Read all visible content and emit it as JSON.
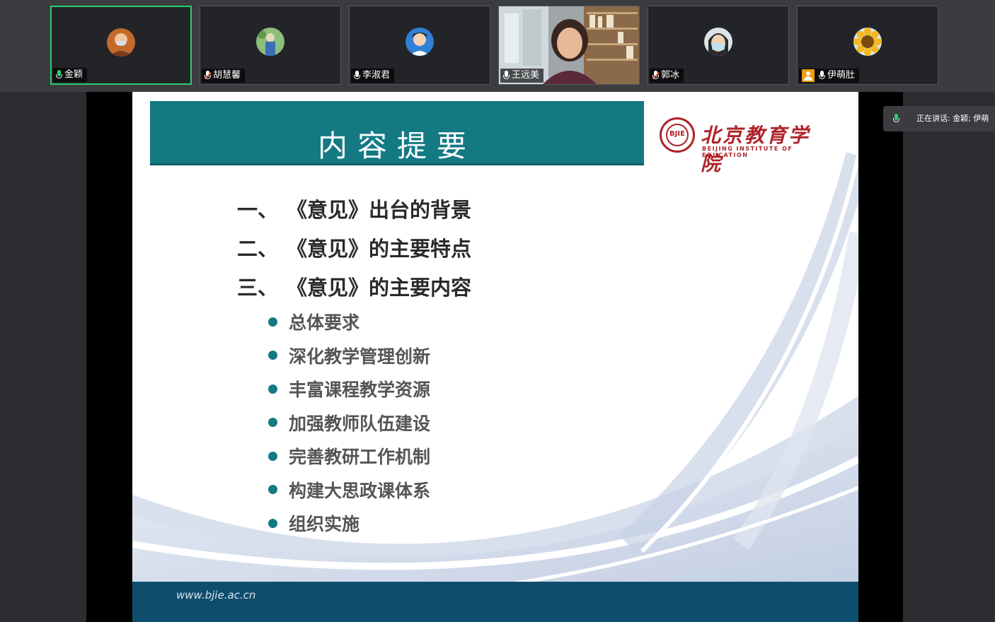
{
  "participants": [
    {
      "name": "金颖",
      "mic": "on-active",
      "active": true,
      "avatar": "photo-woman-glasses-icon"
    },
    {
      "name": "胡慧馨",
      "mic": "muted",
      "active": false,
      "avatar": "photo-outdoor-icon"
    },
    {
      "name": "李淑君",
      "mic": "on",
      "active": false,
      "avatar": "photo-woman-icon"
    },
    {
      "name": "王远美",
      "mic": "on",
      "active": false,
      "avatar": "video-feed"
    },
    {
      "name": "郭冰",
      "mic": "muted",
      "active": false,
      "avatar": "photo-masked-icon"
    },
    {
      "name": "伊萌肚",
      "mic": "on",
      "active": false,
      "avatar": "sunflower-icon"
    }
  ],
  "speaking": {
    "text": "正在讲话: 金颖; 伊萌"
  },
  "slide": {
    "title": "内容提要",
    "logo_cn": "北京教育学院",
    "logo_en": "BEIJING INSTITUTE OF EDUCATION",
    "seal_text": "BJIE",
    "headings": [
      {
        "num": "一、",
        "text": "《意见》出台的背景"
      },
      {
        "num": "二、",
        "text": "《意见》的主要特点"
      },
      {
        "num": "三、",
        "text": "《意见》的主要内容"
      }
    ],
    "items": [
      "总体要求",
      "深化教学管理创新",
      "丰富课程教学资源",
      "加强教师队伍建设",
      "完善教研工作机制",
      "构建大思政课体系",
      "组织实施"
    ],
    "footer_url": "www.bjie.ac.cn"
  },
  "colors": {
    "accent": "#137a84",
    "brand_red": "#b0232a",
    "footer": "#0f4d6f",
    "active_border": "#2ecc71"
  }
}
